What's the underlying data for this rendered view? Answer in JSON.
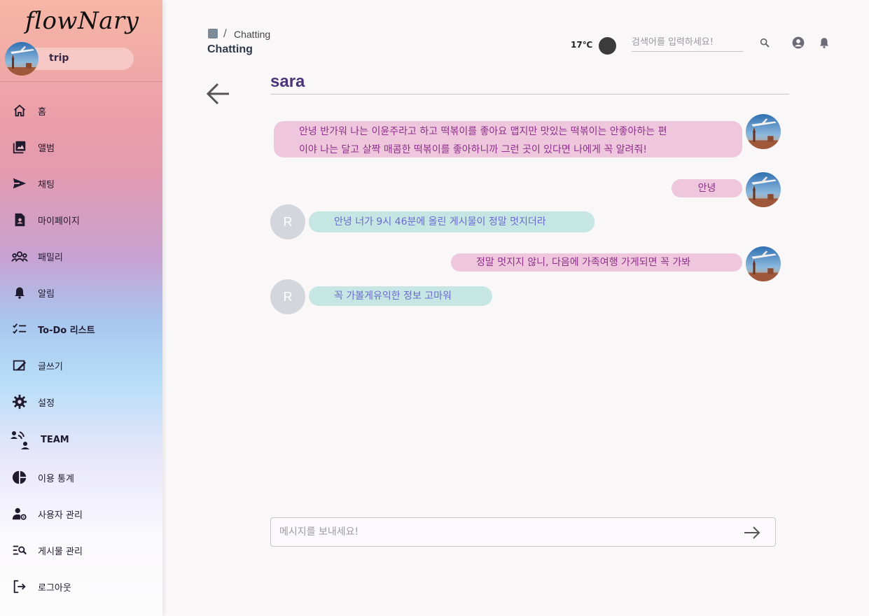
{
  "app": {
    "logo": "flowNary",
    "user_name": "trip"
  },
  "sidebar": {
    "items": [
      {
        "label": "홈",
        "icon": "home-icon"
      },
      {
        "label": "앨범",
        "icon": "album-icon"
      },
      {
        "label": "채팅",
        "icon": "send-icon"
      },
      {
        "label": "마이페이지",
        "icon": "my-page-icon"
      },
      {
        "label": "패밀리",
        "icon": "family-icon"
      },
      {
        "label": "알림",
        "icon": "bell-icon"
      },
      {
        "label": "To-Do 리스트",
        "icon": "checklist-icon"
      },
      {
        "label": "글쓰기",
        "icon": "write-icon"
      },
      {
        "label": "설정",
        "icon": "gear-icon"
      },
      {
        "label": "TEAM",
        "icon": "team-icon"
      },
      {
        "label": "이용 통계",
        "icon": "pie-chart-icon"
      },
      {
        "label": "사용자 관리",
        "icon": "user-settings-icon"
      },
      {
        "label": "게시물 관리",
        "icon": "post-manage-icon"
      },
      {
        "label": "로그아웃",
        "icon": "logout-icon"
      }
    ]
  },
  "header": {
    "breadcrumb": "Chatting",
    "breadcrumb_sep": "/",
    "title": "Chatting",
    "temperature": "17℃",
    "search_placeholder": "검색어를 입력하세요!"
  },
  "chat": {
    "partner": "sara",
    "partner_initial": "R",
    "messages": [
      {
        "from": "me",
        "lines": [
          "안녕 반가워 나는 이윤주라고 하고 떡볶이를 좋아요 맵지만 맛있는 떡볶이는 안좋아하는 편",
          "이야 나는 달고 살짝 매콤한 떡볶이를 좋아하니까 그런 곳이 있다면 나에게 꼭 알려줘!"
        ]
      },
      {
        "from": "me",
        "lines": [
          "안녕"
        ]
      },
      {
        "from": "them",
        "lines": [
          "안녕 너가 9시 46분에 올린 게시물이 정말 멋지더라"
        ]
      },
      {
        "from": "me",
        "lines": [
          "정말 멋지지 않니, 다음에 가족여행 가게되면 꼭 가봐"
        ]
      },
      {
        "from": "them",
        "lines": [
          "꼭 가볼게유익한 정보 고마워"
        ]
      }
    ]
  },
  "composer": {
    "placeholder": "메시지를 보내세요!"
  },
  "colors": {
    "my_bubble": "#eec7dc",
    "my_text": "#8e2f8c",
    "their_bubble": "#c5e6e2",
    "their_text": "#6b6ad0",
    "title": "#4a3578"
  }
}
